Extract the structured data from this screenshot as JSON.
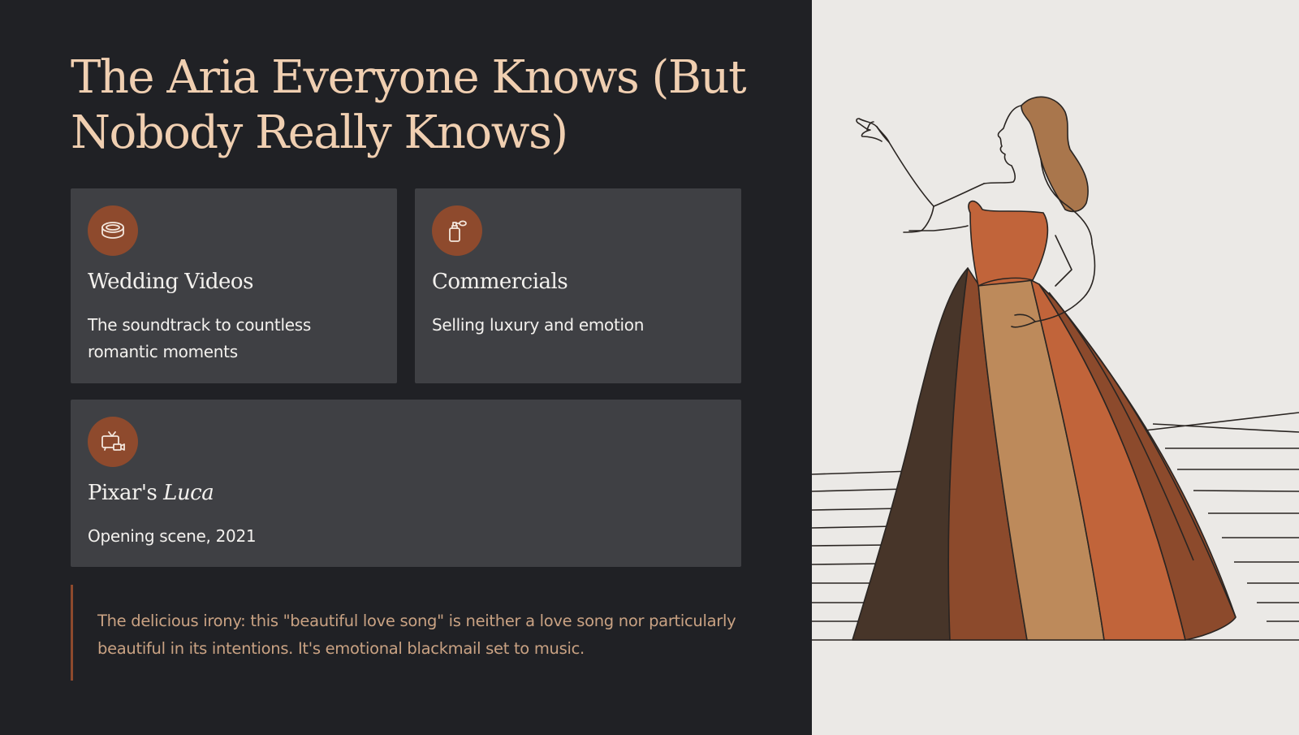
{
  "title": "The Aria Everyone Knows (But Nobody Really Knows)",
  "cards": [
    {
      "icon": "ring-icon",
      "title": "Wedding Videos",
      "description": "The soundtrack to countless romantic moments"
    },
    {
      "icon": "perfume-bottle-icon",
      "title": "Commercials",
      "description": "Selling luxury and emotion"
    },
    {
      "icon": "tv-video-icon",
      "title_prefix": "Pixar's ",
      "title_italic": "Luca",
      "description": "Opening scene, 2021"
    }
  ],
  "quote": "The delicious irony: this \"beautiful love song\" is neither a love song nor particularly beautiful in its intentions. It's emotional blackmail set to music.",
  "colors": {
    "background": "#202125",
    "card": "#3f4044",
    "accent": "#8e4a2d",
    "title": "#f0cfb1",
    "quote_text": "#c9a283",
    "illustration_bg": "#ebe9e6"
  },
  "illustration": "opera-singer-illustration"
}
